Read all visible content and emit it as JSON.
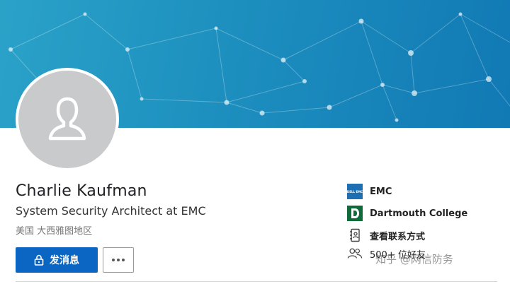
{
  "profile": {
    "name": "Charlie Kaufman",
    "headline": "System Security Architect at EMC",
    "location": "美国 大西雅图地区"
  },
  "actions": {
    "message_label": "发消息",
    "more_label": "..."
  },
  "side": {
    "company": "EMC",
    "company_logo_text": "DELL EMC",
    "school": "Dartmouth College",
    "contact_info": "查看联系方式",
    "connections": "500+ 位好友"
  },
  "watermark": "知乎 @网信防务",
  "colors": {
    "banner_start": "#2aa2c8",
    "banner_end": "#1179b4",
    "primary_button": "#0a66c2",
    "avatar_bg": "#c9cacb",
    "dartmouth_green": "#0f6a3a"
  },
  "icons": {
    "avatar": "person-silhouette-icon",
    "lock": "lock-icon",
    "contact": "contact-card-icon",
    "connections": "people-icon"
  }
}
